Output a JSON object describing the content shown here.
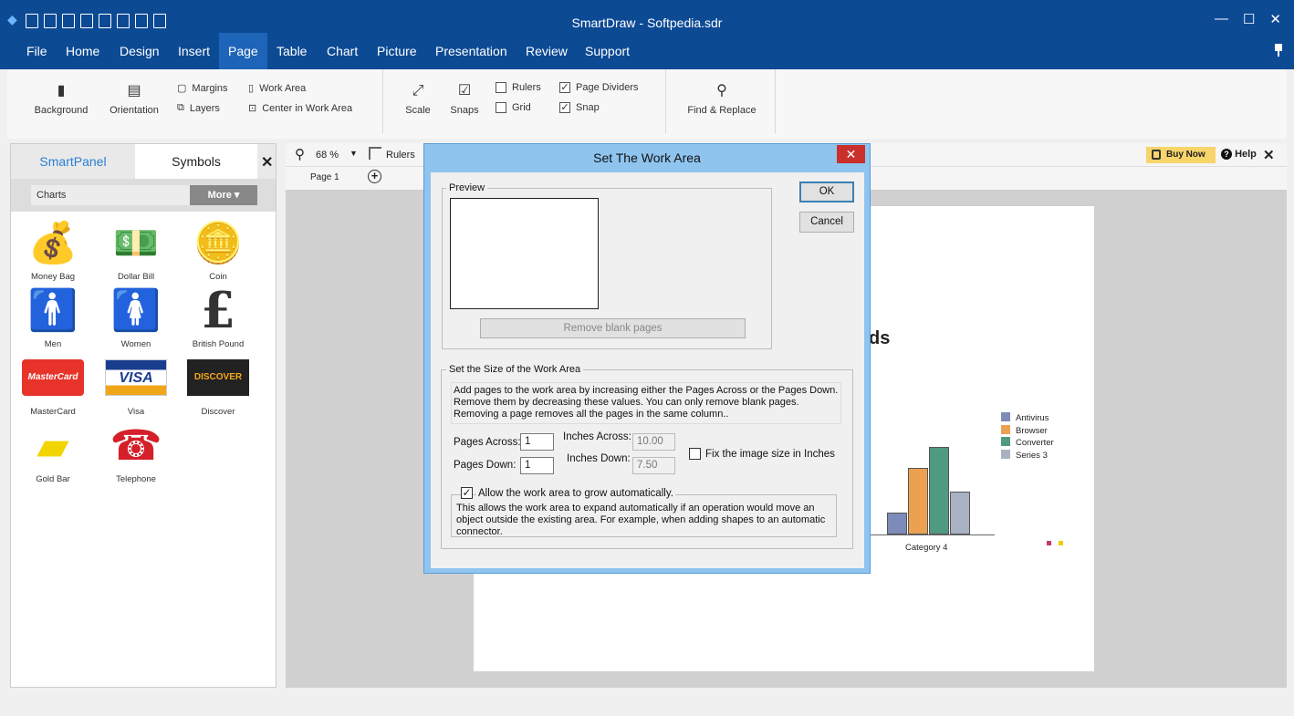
{
  "app": {
    "title": "SmartDraw - Softpedia.sdr",
    "minimize": "—",
    "maximize": "☐",
    "close": "✕",
    "pin": "📌"
  },
  "menu": [
    "File",
    "Home",
    "Design",
    "Insert",
    "Page",
    "Table",
    "Chart",
    "Picture",
    "Presentation",
    "Review",
    "Support"
  ],
  "ribbon": {
    "background": "Background",
    "orientation": "Orientation",
    "margins": "Margins",
    "layers": "Layers",
    "work_area": "Work Area",
    "center_in_work_area": "Center in Work Area",
    "scale": "Scale",
    "snaps": "Snaps",
    "rulers": "Rulers",
    "grid": "Grid",
    "page_dividers": "Page Dividers",
    "snap": "Snap",
    "find_replace": "Find & Replace"
  },
  "left_panel": {
    "tab_smartpanel": "SmartPanel",
    "tab_symbols": "Symbols",
    "close": "✕",
    "category": "Charts",
    "more": "More ▾",
    "symbols": [
      {
        "label": "Money Bag",
        "glyph": "💰"
      },
      {
        "label": "Dollar Bill",
        "glyph": "💵"
      },
      {
        "label": "Coin",
        "glyph": "🪙"
      },
      {
        "label": "Men",
        "glyph": "🚹"
      },
      {
        "label": "Women",
        "glyph": "🚺"
      },
      {
        "label": "British Pound",
        "glyph": "£"
      },
      {
        "label": "MasterCard",
        "glyph": "MasterCard"
      },
      {
        "label": "Visa",
        "glyph": "VISA"
      },
      {
        "label": "Discover",
        "glyph": "DISCOVER"
      },
      {
        "label": "Gold Bar",
        "glyph": "▰"
      },
      {
        "label": "Telephone",
        "glyph": "☎"
      }
    ]
  },
  "canvas": {
    "zoom": "68 %",
    "rulers": "Rulers",
    "page_tab": "Page 1",
    "buy_now": "Buy Now",
    "help": "Help",
    "close": "✕",
    "partial_title": "ds",
    "category_label": "Category 4",
    "legend": [
      {
        "name": "Antivirus",
        "color": "#7d8bb8"
      },
      {
        "name": "Browser",
        "color": "#eba150"
      },
      {
        "name": "Converter",
        "color": "#4f9a80"
      },
      {
        "name": "Series 3",
        "color": "#a9b2c2"
      }
    ]
  },
  "dialog": {
    "title": "Set The Work Area",
    "close": "✕",
    "preview_legend": "Preview",
    "remove_blank_pages": "Remove blank pages",
    "ok": "OK",
    "cancel": "Cancel",
    "size_legend": "Set the Size of the Work Area",
    "size_info": "Add pages to the work area by increasing either the Pages Across or the Pages Down. Remove them by decreasing these values.  You can only remove blank pages. Removing a page removes all the pages in the same column..",
    "pages_across_label": "Pages Across:",
    "pages_across_value": "1",
    "pages_down_label": "Pages Down:",
    "pages_down_value": "1",
    "inches_across_label": "Inches Across:",
    "inches_across_value": "10.00",
    "inches_down_label": "Inches Down:",
    "inches_down_value": "7.50",
    "fix_image_label": "Fix the image size in Inches",
    "allow_grow_label": "Allow the work area to grow automatically.",
    "allow_grow_info": "This allows the work area to expand automatically if an operation would move an object outside the existing area. For example, when adding shapes to an automatic connector."
  }
}
